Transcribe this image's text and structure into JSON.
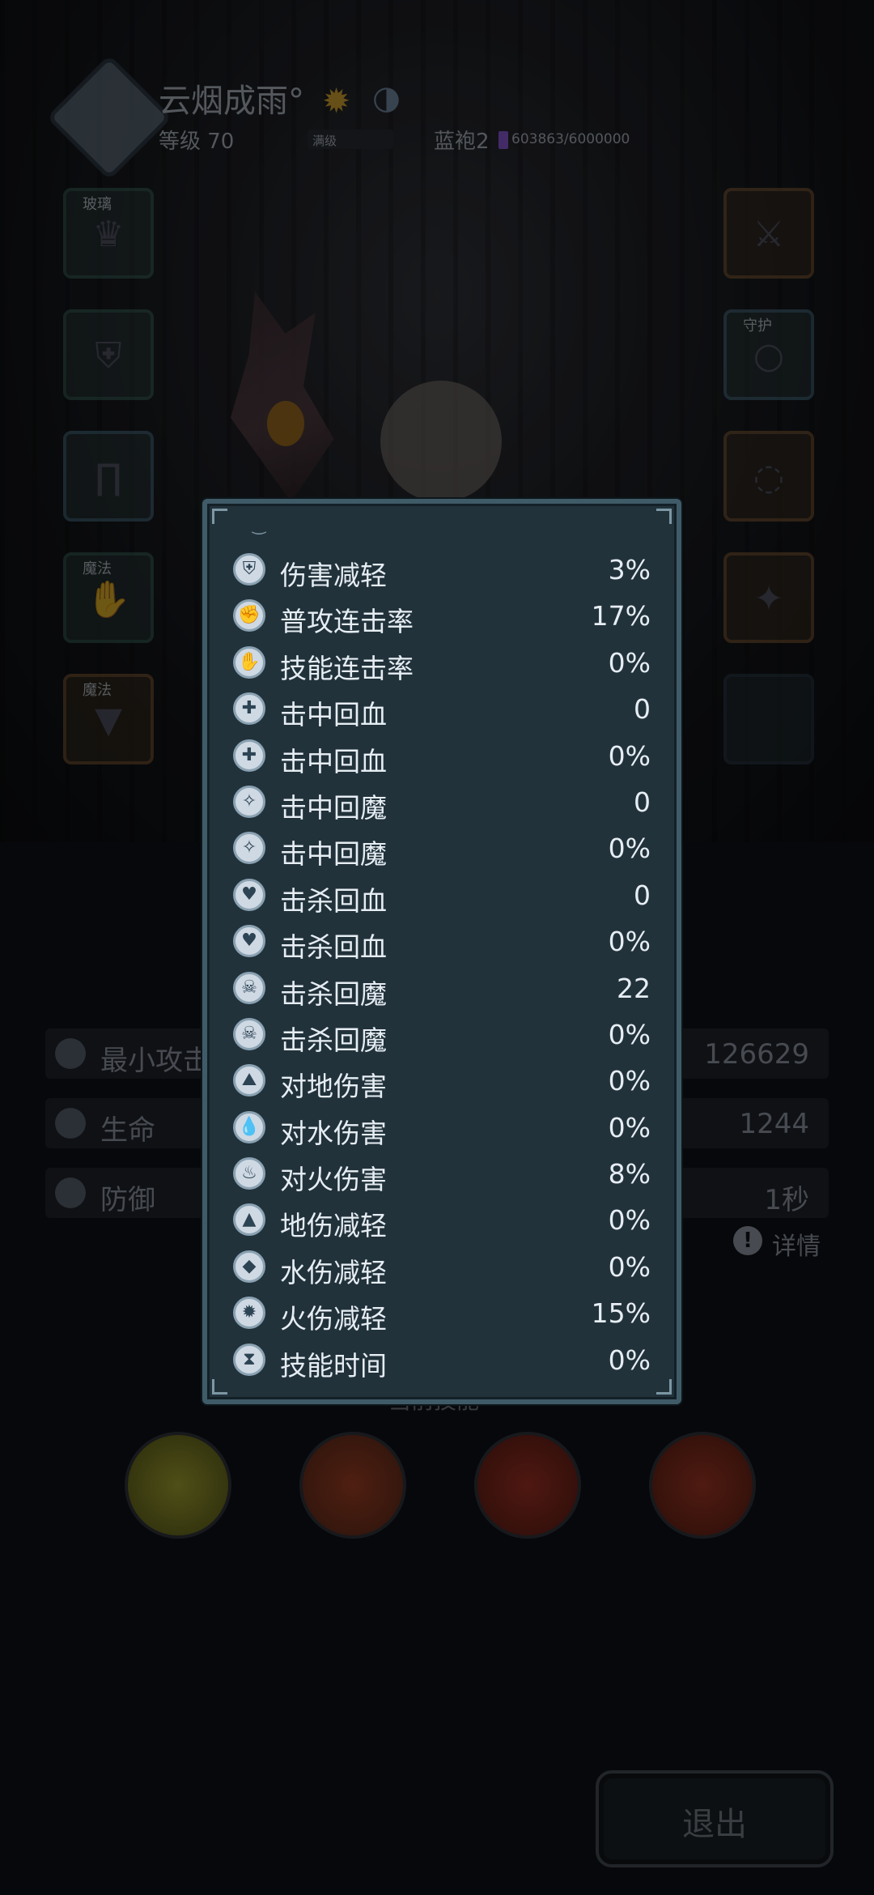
{
  "header": {
    "player_name": "云烟成雨°",
    "level_text": "等级 70",
    "exp_label": "满级",
    "rank_text": "蓝袍2",
    "rank_progress": "603863/6000000",
    "rank_progress_fraction": 0.1006
  },
  "slots": {
    "left": [
      {
        "tag": "玻璃",
        "icon": "helmet-icon"
      },
      {
        "tag": "",
        "icon": "armor-icon"
      },
      {
        "tag": "",
        "icon": "pants-icon"
      },
      {
        "tag": "魔法",
        "icon": "gauntlet-icon"
      },
      {
        "tag": "魔法",
        "icon": "cloak-icon"
      }
    ],
    "right": [
      {
        "tag": "",
        "icon": "weapon-icon"
      },
      {
        "tag": "守护",
        "icon": "ring-icon"
      },
      {
        "tag": "",
        "icon": "necklace-icon"
      },
      {
        "tag": "",
        "icon": "charm-icon"
      }
    ]
  },
  "background_stats": [
    {
      "label": "最小攻击",
      "value": "126629",
      "icon": "attack-icon"
    },
    {
      "label": "生命",
      "value": "1244",
      "icon": "heart-icon"
    },
    {
      "label": "防御",
      "value": "1秒",
      "icon": "shield-icon"
    }
  ],
  "detail_label": "详情",
  "skills_label": "当前技能",
  "exit_label": "退出",
  "attributes": [
    {
      "label": "伤害减轻",
      "value": "3%",
      "icon": "armor-reduce-icon"
    },
    {
      "label": "普攻连击率",
      "value": "17%",
      "icon": "combo-icon"
    },
    {
      "label": "技能连击率",
      "value": "0%",
      "icon": "skill-combo-icon"
    },
    {
      "label": "击中回血",
      "value": "0",
      "icon": "hit-heal-icon"
    },
    {
      "label": "击中回血",
      "value": "0%",
      "icon": "hit-heal-icon"
    },
    {
      "label": "击中回魔",
      "value": "0",
      "icon": "hit-mana-icon"
    },
    {
      "label": "击中回魔",
      "value": "0%",
      "icon": "hit-mana-icon"
    },
    {
      "label": "击杀回血",
      "value": "0",
      "icon": "kill-heal-icon"
    },
    {
      "label": "击杀回血",
      "value": "0%",
      "icon": "kill-heal-icon"
    },
    {
      "label": "击杀回魔",
      "value": "22",
      "icon": "kill-mana-icon"
    },
    {
      "label": "击杀回魔",
      "value": "0%",
      "icon": "kill-mana-icon"
    },
    {
      "label": "对地伤害",
      "value": "0%",
      "icon": "earth-icon"
    },
    {
      "label": "对水伤害",
      "value": "0%",
      "icon": "water-icon"
    },
    {
      "label": "对火伤害",
      "value": "8%",
      "icon": "fire-icon"
    },
    {
      "label": "地伤减轻",
      "value": "0%",
      "icon": "earth-shield-icon"
    },
    {
      "label": "水伤减轻",
      "value": "0%",
      "icon": "water-shield-icon"
    },
    {
      "label": "火伤减轻",
      "value": "15%",
      "icon": "fire-shield-icon"
    },
    {
      "label": "技能时间",
      "value": "0%",
      "icon": "hourglass-icon"
    }
  ]
}
